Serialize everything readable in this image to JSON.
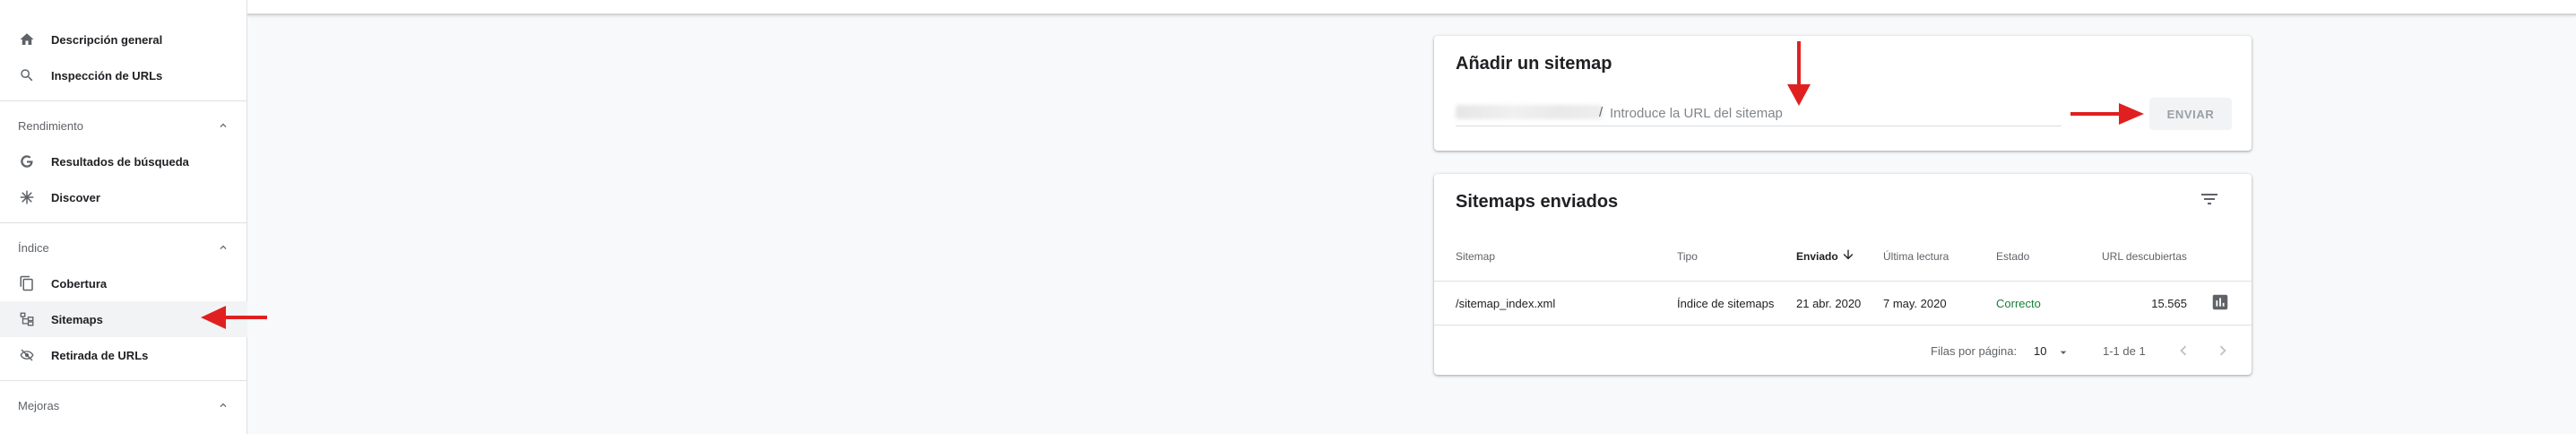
{
  "sidebar": {
    "overview_label": "Descripción general",
    "url_inspection_label": "Inspección de URLs",
    "sections": {
      "performance": "Rendimiento",
      "index": "Índice",
      "enhancements": "Mejoras"
    },
    "search_results_label": "Resultados de búsqueda",
    "discover_label": "Discover",
    "coverage_label": "Cobertura",
    "sitemaps_label": "Sitemaps",
    "removals_label": "Retirada de URLs"
  },
  "add_sitemap": {
    "title": "Añadir un sitemap",
    "url_prefix": "/",
    "input_placeholder": "Introduce la URL del sitemap",
    "submit_label": "ENVIAR"
  },
  "submitted": {
    "title": "Sitemaps enviados",
    "columns": {
      "sitemap": "Sitemap",
      "type": "Tipo",
      "submitted": "Enviado",
      "last_read": "Última lectura",
      "status": "Estado",
      "discovered_urls": "URL descubiertas"
    },
    "rows": [
      {
        "sitemap": "/sitemap_index.xml",
        "type": "Índice de sitemaps",
        "submitted": "21 abr. 2020",
        "last_read": "7 may. 2020",
        "status": "Correcto",
        "discovered_urls": "15.565"
      }
    ],
    "pagination": {
      "rows_per_page_label": "Filas por página:",
      "rows_per_page_value": "10",
      "range": "1-1 de 1"
    }
  },
  "colors": {
    "annotation_arrow": "#e02020",
    "status_ok": "#188038"
  }
}
